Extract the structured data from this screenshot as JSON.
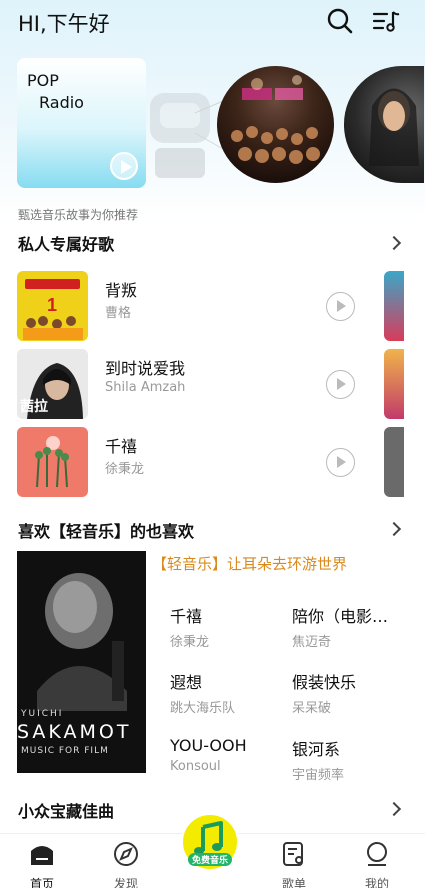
{
  "header": {
    "greeting": "HI,下午好"
  },
  "carousel": {
    "radio_title_line1": "POP",
    "radio_title_line2": "Radio"
  },
  "recommend_subtitle": "甄选音乐故事为你推荐",
  "section1": {
    "title": "私人专属好歌",
    "songs": [
      {
        "name": "背叛",
        "artist": "曹格",
        "cover_text": ""
      },
      {
        "name": "到时说爱我",
        "artist": "Shila Amzah",
        "cover_text": "茜拉"
      },
      {
        "name": "千禧",
        "artist": "徐秉龙",
        "cover_text": ""
      }
    ]
  },
  "section2": {
    "title": "喜欢【轻音乐】的也喜欢",
    "playlist_title": "【轻音乐】让耳朵去环游世界",
    "cover_text_top": "YUICHI",
    "cover_text_main": "SAKAMOT",
    "cover_text_sub": "MUSIC FOR FILM",
    "songs": [
      {
        "name": "千禧",
        "artist": "徐秉龙"
      },
      {
        "name": "陪你（电影…",
        "artist": "焦迈奇"
      },
      {
        "name": "遐想",
        "artist": "跳大海乐队"
      },
      {
        "name": "假装快乐",
        "artist": "呆呆破"
      },
      {
        "name": "YOU-OOH",
        "artist": "Konsoul"
      },
      {
        "name": "银河系",
        "artist": "宇宙频率"
      }
    ]
  },
  "section3": {
    "title": "小众宝藏佳曲"
  },
  "nav": {
    "items": [
      {
        "label": "首页",
        "icon": "home-icon"
      },
      {
        "label": "发现",
        "icon": "discover-icon"
      },
      {
        "label": "歌单",
        "icon": "song-list-icon"
      },
      {
        "label": "我的",
        "icon": "profile-icon"
      }
    ],
    "center_label": "免费音乐"
  },
  "colors": {
    "accent_orange": "#d98a1e",
    "center_yellow": "#f4ec00",
    "center_green": "#22b46a"
  }
}
